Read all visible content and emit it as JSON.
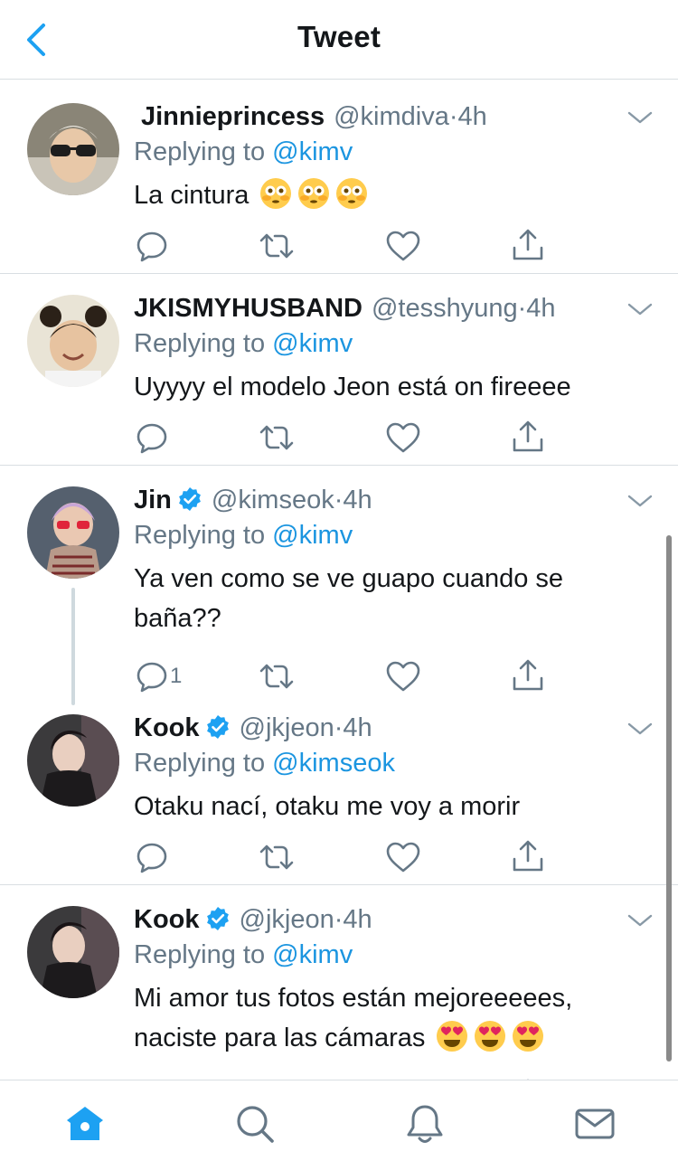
{
  "header": {
    "title": "Tweet",
    "back_icon": "back-chevron-icon"
  },
  "colors": {
    "accent": "#1da1f2",
    "mention": "#1b95e0",
    "secondary_text": "#657786",
    "divider": "#d9dee2"
  },
  "tweets": [
    {
      "name": "Jinnieprincess",
      "handle": "@kimdiva",
      "dot": "·",
      "time": "4h",
      "verified": false,
      "replying_prefix": "Replying to",
      "replying_to": "@kimv",
      "text": "La cintura",
      "emojis": [
        "flushed-face-icon",
        "flushed-face-icon",
        "flushed-face-icon"
      ],
      "reply_count": ""
    },
    {
      "name": "JKISMYHUSBAND",
      "handle": "@tesshyung",
      "dot": "·",
      "time": "4h",
      "verified": false,
      "replying_prefix": "Replying to",
      "replying_to": "@kimv",
      "text": "Uyyyy el modelo Jeon está on fireeee",
      "emojis": [],
      "reply_count": ""
    },
    {
      "name": "Jin",
      "handle": "@kimseok",
      "dot": "·",
      "time": "4h",
      "verified": true,
      "replying_prefix": "Replying to",
      "replying_to": "@kimv",
      "text": "Ya ven como se ve guapo cuando se baña??",
      "emojis": [],
      "reply_count": "1"
    },
    {
      "name": "Kook",
      "handle": "@jkjeon",
      "dot": "·",
      "time": "4h",
      "verified": true,
      "replying_prefix": "Replying to",
      "replying_to": "@kimseok",
      "text": "Otaku nací, otaku me voy a morir",
      "emojis": [],
      "reply_count": ""
    },
    {
      "name": "Kook",
      "handle": "@jkjeon",
      "dot": "·",
      "time": "4h",
      "verified": true,
      "replying_prefix": "Replying to",
      "replying_to": "@kimv",
      "text": "Mi amor tus fotos están mejoreeeees, naciste para las cámaras",
      "emojis": [
        "heart-eyes-icon",
        "heart-eyes-icon",
        "heart-eyes-icon"
      ],
      "reply_count": ""
    }
  ],
  "tabbar": {
    "items": [
      "home-icon",
      "search-icon",
      "notifications-bell-icon",
      "messages-envelope-icon"
    ],
    "active": "home-icon"
  }
}
